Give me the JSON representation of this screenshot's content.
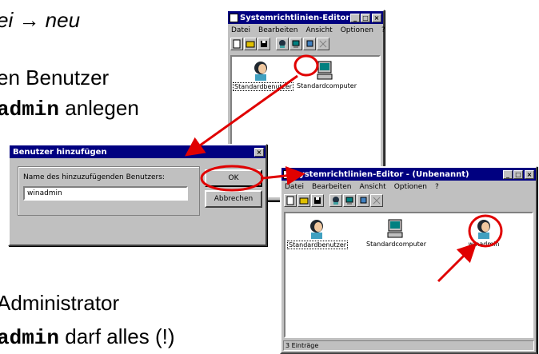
{
  "slide": {
    "line1": "ei → neu",
    "line2": "en Benutzer",
    "line3_mono": "admin",
    "line3_rest": " anlegen",
    "line4": "Administrator",
    "line5_mono": "admin",
    "line5_rest": " darf alles (!)"
  },
  "editor1": {
    "title": "Systemrichtlinien-Editor - (Unbenannt)",
    "menu": [
      "Datei",
      "Bearbeiten",
      "Ansicht",
      "Optionen",
      "?"
    ],
    "items": [
      "Standardbenutzer",
      "Standardcomputer"
    ]
  },
  "dialog": {
    "title": "Benutzer hinzufügen",
    "prompt": "Name des hinzuzufügenden Benutzers:",
    "input_value": "winadmin",
    "ok_label": "OK",
    "cancel_label": "Abbrechen",
    "close_label": "×"
  },
  "editor2": {
    "title": "Systemrichtlinien-Editor - (Unbenannt)",
    "menu": [
      "Datei",
      "Bearbeiten",
      "Ansicht",
      "Optionen",
      "?"
    ],
    "items": [
      "Standardbenutzer",
      "Standardcomputer",
      "winadmin"
    ],
    "status": "3 Einträge"
  },
  "colors": {
    "annotation": "#e00000",
    "titlebar": "#000080",
    "face": "#c0c0c0"
  }
}
